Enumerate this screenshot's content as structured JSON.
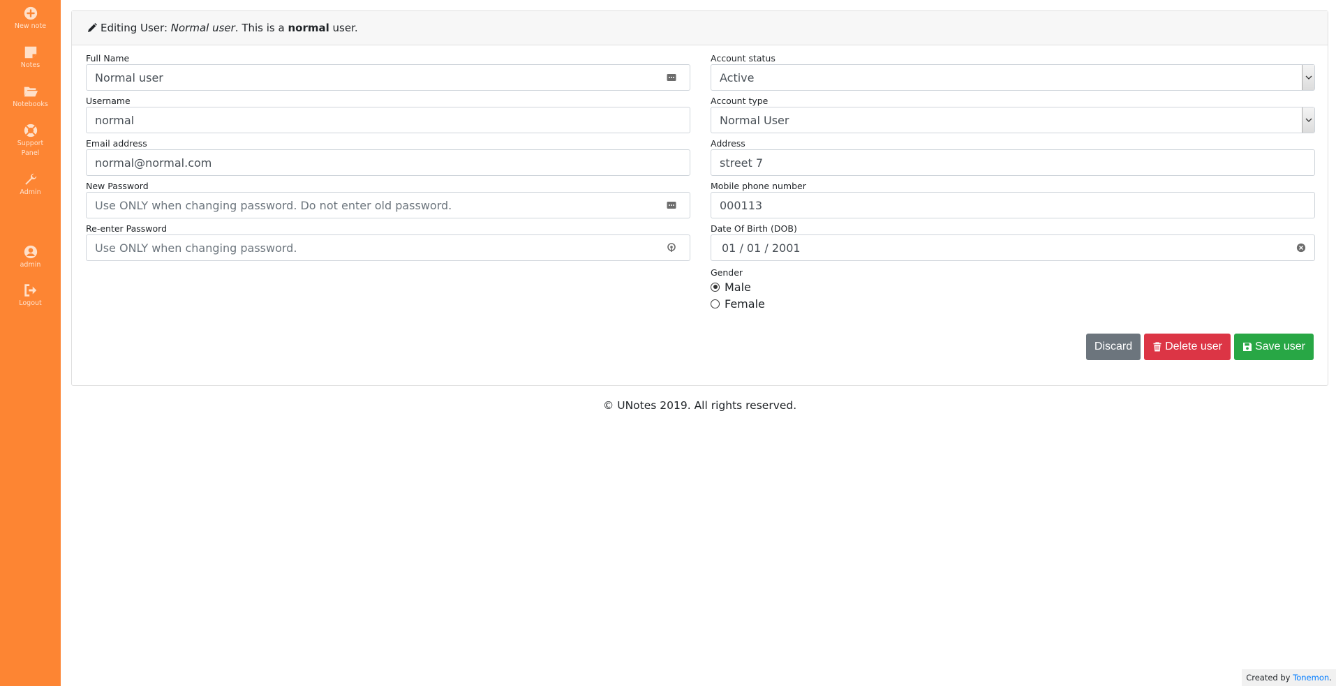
{
  "sidebar": {
    "items": [
      {
        "label": "New note",
        "icon": "plus-circle-icon"
      },
      {
        "label": "Notes",
        "icon": "sticky-note-icon"
      },
      {
        "label": "Notebooks",
        "icon": "folder-open-icon"
      },
      {
        "label": "Support Panel",
        "icon": "lifebuoy-icon"
      },
      {
        "label": "Admin",
        "icon": "wrench-icon"
      },
      {
        "label": "admin",
        "icon": "user-circle-icon"
      },
      {
        "label": "Logout",
        "icon": "sign-out-icon"
      }
    ]
  },
  "header": {
    "prefix": "Editing User: ",
    "name": "Normal user",
    "mid": ". This is a ",
    "role": "normal",
    "suffix": " user."
  },
  "form": {
    "full_name": {
      "label": "Full Name",
      "value": "Normal user"
    },
    "username": {
      "label": "Username",
      "value": "normal"
    },
    "email": {
      "label": "Email address",
      "value": "normal@normal.com"
    },
    "new_password": {
      "label": "New Password",
      "placeholder": "Use ONLY when changing password. Do not enter old password."
    },
    "reenter_password": {
      "label": "Re-enter Password",
      "placeholder": "Use ONLY when changing password."
    },
    "account_status": {
      "label": "Account status",
      "value": "Active"
    },
    "account_type": {
      "label": "Account type",
      "value": "Normal User"
    },
    "address": {
      "label": "Address",
      "value": "street 7"
    },
    "mobile": {
      "label": "Mobile phone number",
      "value": "000113"
    },
    "dob": {
      "label": "Date Of Birth (DOB)",
      "value": "01 / 01 / 2001"
    },
    "gender": {
      "label": "Gender",
      "options": [
        "Male",
        "Female"
      ],
      "selected": "Male"
    }
  },
  "buttons": {
    "discard": "Discard",
    "delete": "Delete user",
    "save": "Save user"
  },
  "footer": {
    "copyright": "© UNotes 2019. All rights reserved.",
    "credit_prefix": "Created by ",
    "credit_link": "Tonemon",
    "credit_suffix": "."
  },
  "colors": {
    "sidebar": "#fd8533",
    "discard": "#6c757d",
    "delete": "#dc3545",
    "save": "#28a745",
    "link": "#007bff"
  }
}
